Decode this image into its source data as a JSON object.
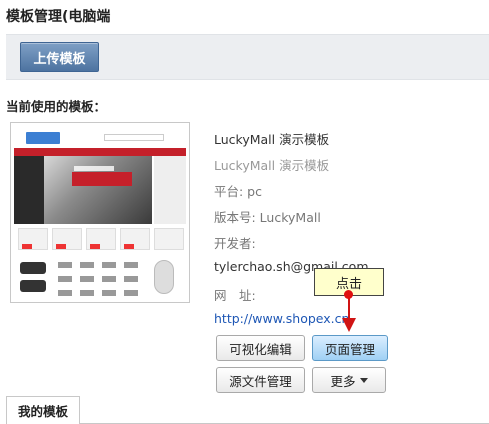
{
  "page": {
    "title": "模板管理(电脑端"
  },
  "toolbar": {
    "upload_label": "上传模板"
  },
  "current": {
    "label": "当前使用的模板：",
    "name": "LuckyMall 演示模板",
    "subtitle": "LuckyMall 演示模板",
    "platform": "平台: pc",
    "version": "版本号: LuckyMall",
    "developer": "开发者:",
    "email": "tylerchao.sh@gmail.com",
    "website_label": "网　址:",
    "website": "http://www.shopex.cn"
  },
  "buttons": {
    "visual_edit": "可视化编辑",
    "page_manage": "页面管理",
    "source_manage": "源文件管理",
    "more": "更多"
  },
  "callout": {
    "text": "点击"
  },
  "tabs": {
    "my_templates": "我的模板"
  },
  "colors": {
    "accent": "#4d73a0",
    "callout_bg": "#ffffcc",
    "arrow": "#d01414",
    "link": "#1e57b5"
  }
}
